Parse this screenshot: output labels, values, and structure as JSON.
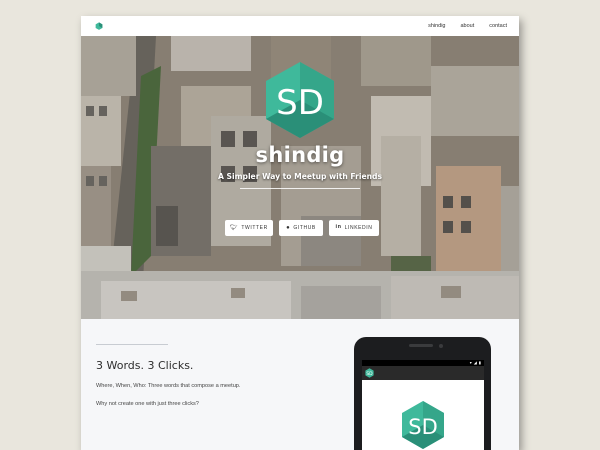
{
  "nav": {
    "logo_icon": "shindig-logo-icon",
    "links": [
      "shindig",
      "about",
      "contact"
    ]
  },
  "hero": {
    "logo_text": "SD",
    "title": "shindig",
    "tagline": "A Simpler Way to Meetup with Friends",
    "buttons": [
      {
        "label": "TWITTER",
        "icon": "twitter-icon"
      },
      {
        "label": "GITHUB",
        "icon": "github-icon"
      },
      {
        "label": "LINKEDIN",
        "icon": "linkedin-icon"
      }
    ]
  },
  "section": {
    "heading": "3 Words. 3 Clicks.",
    "paragraph1": "Where, When, Who: Three words that compose a meetup.",
    "paragraph2": "Why not create one with just three clicks?"
  },
  "phone": {
    "app_logo_text": "SD",
    "screen_logo_text": "SD"
  },
  "colors": {
    "brand_teal": "#3fb99b",
    "brand_teal_dark": "#2a8f78",
    "page_bg": "#e9e6dd",
    "section_bg": "#f6f7f9"
  }
}
